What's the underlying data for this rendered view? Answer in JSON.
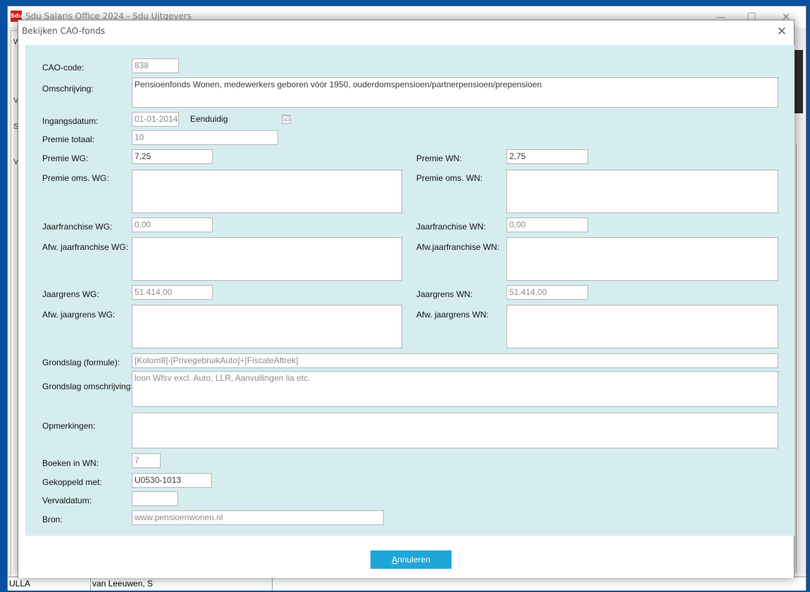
{
  "app": {
    "logo_text": "Sdu",
    "title": "Sdu Salaris Office 2024 - Sdu Uitgevers",
    "left_strip_chars": [
      "W",
      "V",
      "S",
      "V"
    ],
    "minimize": "—",
    "maximize": "☐",
    "close": "✕"
  },
  "statusbar": {
    "user": "ULLA",
    "name": "van Leeuwen, S"
  },
  "dialog": {
    "title": "Bekijken CAO-fonds",
    "close": "✕",
    "fields": {
      "cao_code": {
        "label": "CAO-code:",
        "value": "838"
      },
      "omschrijving": {
        "label": "Omschrijving:",
        "value": "Pensioenfonds Wonen, medewerkers geboren vóór 1950, ouderdomspensioen/partnerpensioen/prepensioen"
      },
      "ingangsdatum": {
        "label": "Ingangsdatum:",
        "value": "01-01-2014"
      },
      "eenduidig": {
        "label": "Eenduidig",
        "checked": "☑"
      },
      "premie_totaal": {
        "label": "Premie totaal:",
        "value": "10"
      },
      "premie_wg": {
        "label": "Premie WG:",
        "value": "7,25"
      },
      "premie_wn": {
        "label": "Premie WN:",
        "value": "2,75"
      },
      "premie_oms_wg": {
        "label": "Premie oms. WG:",
        "value": ""
      },
      "premie_oms_wn": {
        "label": "Premie oms. WN:",
        "value": ""
      },
      "jaarfranchise_wg": {
        "label": "Jaarfranchise WG:",
        "value": "0,00"
      },
      "jaarfranchise_wn": {
        "label": "Jaarfranchise WN:",
        "value": "0,00"
      },
      "afw_jaarfranchise_wg": {
        "label": "Afw. jaarfranchise WG:",
        "value": ""
      },
      "afw_jaarfranchise_wn": {
        "label": "Afw.jaarfranchise WN:",
        "value": ""
      },
      "jaargrens_wg": {
        "label": "Jaargrens WG:",
        "value": "51.414,00"
      },
      "jaargrens_wn": {
        "label": "Jaargrens WN:",
        "value": "51.414,00"
      },
      "afw_jaargrens_wg": {
        "label": "Afw. jaargrens WG:",
        "value": ""
      },
      "afw_jaargrens_wn": {
        "label": "Afw. jaargrens WN:",
        "value": ""
      },
      "grondslag_formule": {
        "label": "Grondslag (formule):",
        "value": "[Kolom8]-[PrivegebruikAuto]+[FiscaleAftrek]"
      },
      "grondslag_omschrijving": {
        "label": "Grondslag omschrijving:",
        "value": "loon Wfsv excl. Auto, LLR, Aanvullingen lia etc."
      },
      "opmerkingen": {
        "label": "Opmerkingen:",
        "value": ""
      },
      "boeken_in_wn": {
        "label": "Boeken in WN:",
        "value": "7"
      },
      "gekoppeld_met": {
        "label": "Gekoppeld met:",
        "value": "U0530-1013"
      },
      "vervaldatum": {
        "label": "Vervaldatum:",
        "value": ""
      },
      "bron": {
        "label": "Bron:",
        "value": "www.pensioenwonen.nl"
      }
    },
    "buttons": {
      "cancel_accel": "A",
      "cancel_rest": "nnuleren"
    }
  },
  "colors": {
    "body_bg": "#d6edf0",
    "accent_button": "#1ea7d6",
    "desktop": "#0a50a0"
  }
}
